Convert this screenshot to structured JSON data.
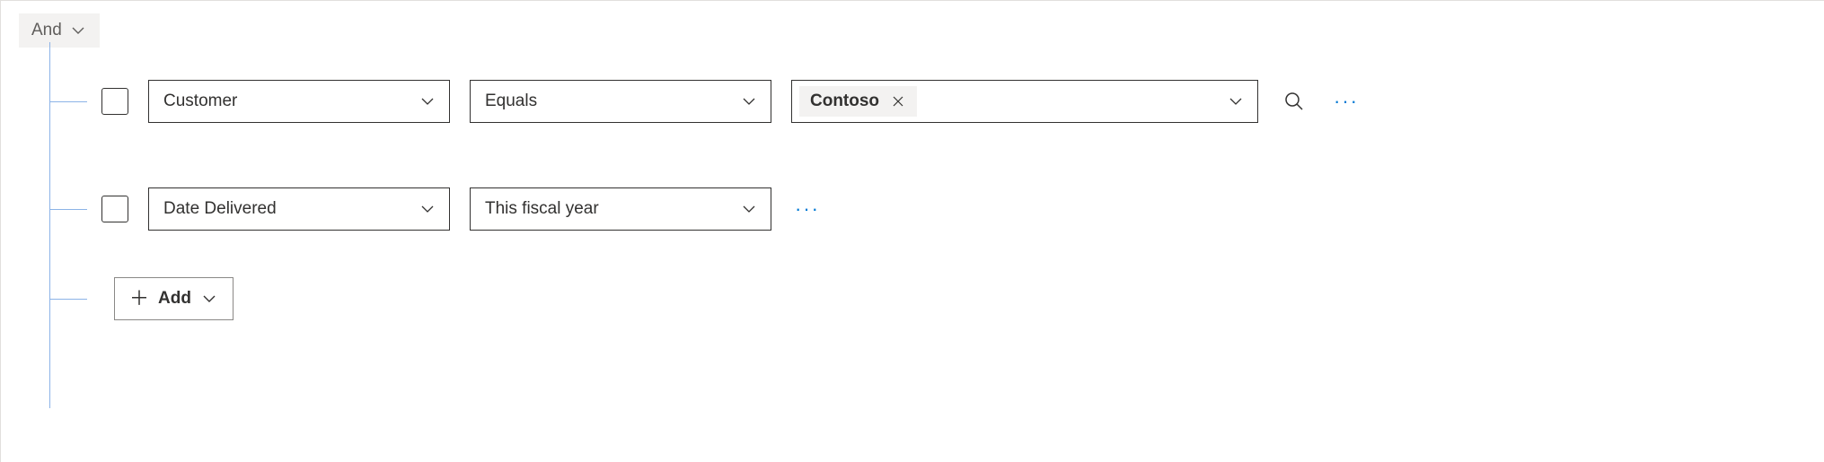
{
  "group": {
    "operator": "And"
  },
  "rows": [
    {
      "field": "Customer",
      "operator": "Equals",
      "value_tag": "Contoso",
      "has_value_picker": true,
      "has_search": true
    },
    {
      "field": "Date Delivered",
      "operator": "This fiscal year",
      "has_value_picker": false,
      "has_search": false
    }
  ],
  "add": {
    "label": "Add"
  }
}
